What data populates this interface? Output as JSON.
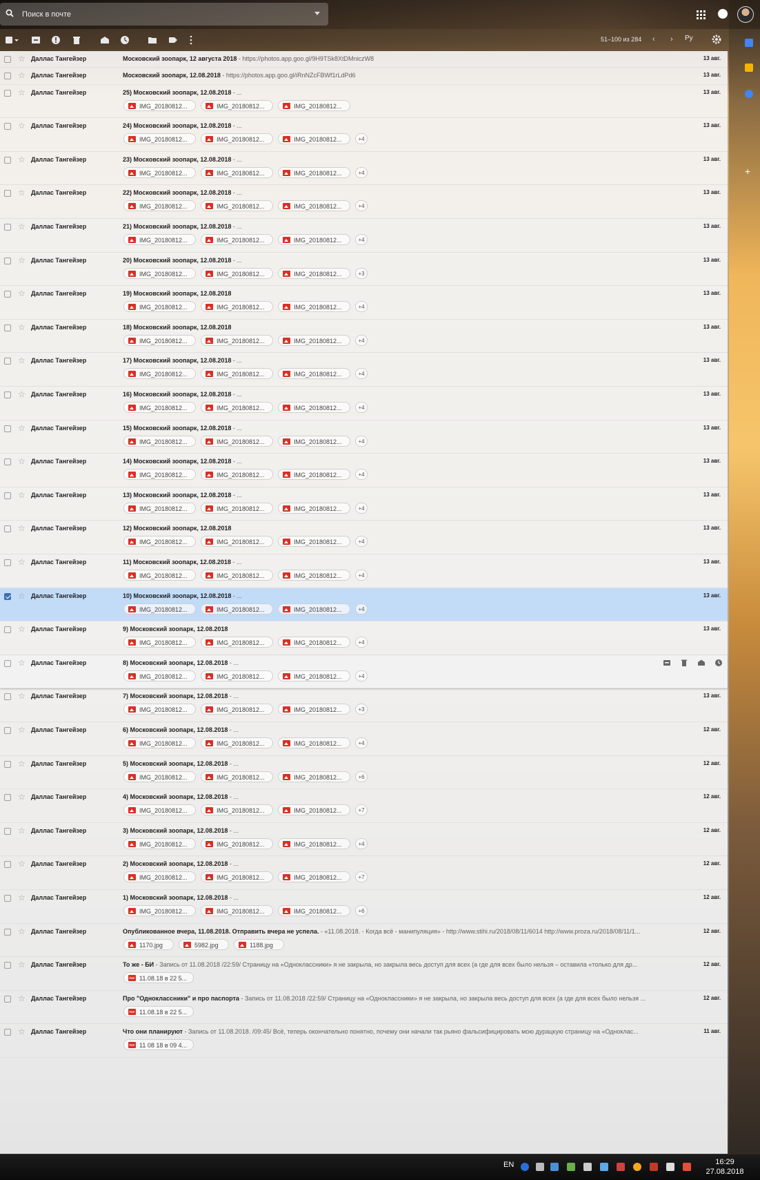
{
  "search": {
    "placeholder": "Поиск в почте"
  },
  "toolbar": {
    "pager": "51–100 из 284",
    "prev": "‹",
    "next": "›",
    "lang": "Ру"
  },
  "colors": {
    "selected_row": "#c2dbf7",
    "attachment_icon": "#d93025",
    "checkbox_checked": "#3c6fb3"
  },
  "emails": [
    {
      "sender": "Даллас Тангейзер",
      "subject": "Московский зоопарк, 12 августа 2018",
      "snippet": " - https://photos.app.goo.gl/9H9TSk8XtDMniczW8",
      "date": "13 авг.",
      "attachments": [],
      "more": ""
    },
    {
      "sender": "Даллас Тангейзер",
      "subject": "Московский зоопарк, 12.08.2018",
      "snippet": " - https://photos.app.goo.gl/iRnNZcFBWf1rLdPd6",
      "date": "13 авг.",
      "attachments": [],
      "more": ""
    },
    {
      "sender": "Даллас Тангейзер",
      "subject": "25) Московский зоопарк, 12.08.2018",
      "snippet": " - ...",
      "date": "13 авг.",
      "attachments": [
        "IMG_20180812...",
        "IMG_20180812...",
        "IMG_20180812..."
      ],
      "more": ""
    },
    {
      "sender": "Даллас Тангейзер",
      "subject": "24) Московский зоопарк, 12.08.2018",
      "snippet": " - ...",
      "date": "13 авг.",
      "attachments": [
        "IMG_20180812...",
        "IMG_20180812...",
        "IMG_20180812..."
      ],
      "more": "+4"
    },
    {
      "sender": "Даллас Тангейзер",
      "subject": "23) Московский зоопарк, 12.08.2018",
      "snippet": " - ...",
      "date": "13 авг.",
      "attachments": [
        "IMG_20180812...",
        "IMG_20180812...",
        "IMG_20180812..."
      ],
      "more": "+4"
    },
    {
      "sender": "Даллас Тангейзер",
      "subject": "22) Московский зоопарк, 12.08.2018",
      "snippet": " - ...",
      "date": "13 авг.",
      "attachments": [
        "IMG_20180812...",
        "IMG_20180812...",
        "IMG_20180812..."
      ],
      "more": "+4"
    },
    {
      "sender": "Даллас Тангейзер",
      "subject": "21) Московский зоопарк, 12.08.2018",
      "snippet": " - ...",
      "date": "13 авг.",
      "attachments": [
        "IMG_20180812...",
        "IMG_20180812...",
        "IMG_20180812..."
      ],
      "more": "+4"
    },
    {
      "sender": "Даллас Тангейзер",
      "subject": "20) Московский зоопарк, 12.08.2018",
      "snippet": " - ...",
      "date": "13 авг.",
      "attachments": [
        "IMG_20180812...",
        "IMG_20180812...",
        "IMG_20180812..."
      ],
      "more": "+3"
    },
    {
      "sender": "Даллас Тангейзер",
      "subject": "19) Московский зоопарк, 12.08.2018",
      "snippet": "",
      "date": "13 авг.",
      "attachments": [
        "IMG_20180812...",
        "IMG_20180812...",
        "IMG_20180812..."
      ],
      "more": "+4"
    },
    {
      "sender": "Даллас Тангейзер",
      "subject": "18) Московский зоопарк, 12.08.2018",
      "snippet": "",
      "date": "13 авг.",
      "attachments": [
        "IMG_20180812...",
        "IMG_20180812...",
        "IMG_20180812..."
      ],
      "more": "+4"
    },
    {
      "sender": "Даллас Тангейзер",
      "subject": "17) Московский зоопарк, 12.08.2018",
      "snippet": " - ...",
      "date": "13 авг.",
      "attachments": [
        "IMG_20180812...",
        "IMG_20180812...",
        "IMG_20180812..."
      ],
      "more": "+4"
    },
    {
      "sender": "Даллас Тангейзер",
      "subject": "16) Московский зоопарк, 12.08.2018",
      "snippet": " - ...",
      "date": "13 авг.",
      "attachments": [
        "IMG_20180812...",
        "IMG_20180812...",
        "IMG_20180812..."
      ],
      "more": "+4"
    },
    {
      "sender": "Даллас Тангейзер",
      "subject": "15) Московский зоопарк, 12.08.2018",
      "snippet": " - ...",
      "date": "13 авг.",
      "attachments": [
        "IMG_20180812...",
        "IMG_20180812...",
        "IMG_20180812..."
      ],
      "more": "+4"
    },
    {
      "sender": "Даллас Тангейзер",
      "subject": "14) Московский зоопарк, 12.08.2018",
      "snippet": " - ...",
      "date": "13 авг.",
      "attachments": [
        "IMG_20180812...",
        "IMG_20180812...",
        "IMG_20180812..."
      ],
      "more": "+4"
    },
    {
      "sender": "Даллас Тангейзер",
      "subject": "13) Московский зоопарк, 12.08.2018",
      "snippet": " - ...",
      "date": "13 авг.",
      "attachments": [
        "IMG_20180812...",
        "IMG_20180812...",
        "IMG_20180812..."
      ],
      "more": "+4"
    },
    {
      "sender": "Даллас Тангейзер",
      "subject": "12) Московский зоопарк, 12.08.2018",
      "snippet": "",
      "date": "13 авг.",
      "attachments": [
        "IMG_20180812...",
        "IMG_20180812...",
        "IMG_20180812..."
      ],
      "more": "+4"
    },
    {
      "sender": "Даллас Тангейзер",
      "subject": "11) Московский зоопарк, 12.08.2018",
      "snippet": " - ...",
      "date": "13 авг.",
      "attachments": [
        "IMG_20180812...",
        "IMG_20180812...",
        "IMG_20180812..."
      ],
      "more": "+4"
    },
    {
      "sender": "Даллас Тангейзер",
      "subject": "10) Московский зоопарк, 12.08.2018",
      "snippet": " - ...",
      "date": "13 авг.",
      "attachments": [
        "IMG_20180812...",
        "IMG_20180812...",
        "IMG_20180812..."
      ],
      "more": "+4",
      "selected": true
    },
    {
      "sender": "Даллас Тангейзер",
      "subject": "9) Московский зоопарк, 12.08.2018",
      "snippet": "",
      "date": "13 авг.",
      "attachments": [
        "IMG_20180812...",
        "IMG_20180812...",
        "IMG_20180812..."
      ],
      "more": "+4"
    },
    {
      "sender": "Даллас Тангейзер",
      "subject": "8) Московский зоопарк, 12.08.2018",
      "snippet": " - ...",
      "date": "",
      "attachments": [
        "IMG_20180812...",
        "IMG_20180812...",
        "IMG_20180812..."
      ],
      "more": "+4",
      "hovered": true
    },
    {
      "sender": "Даллас Тангейзер",
      "subject": "7) Московский зоопарк, 12.08.2018",
      "snippet": " - ...",
      "date": "13 авг.",
      "attachments": [
        "IMG_20180812...",
        "IMG_20180812...",
        "IMG_20180812..."
      ],
      "more": "+3"
    },
    {
      "sender": "Даллас Тангейзер",
      "subject": "6) Московский зоопарк, 12.08.2018",
      "snippet": " - ...",
      "date": "12 авг.",
      "attachments": [
        "IMG_20180812...",
        "IMG_20180812...",
        "IMG_20180812..."
      ],
      "more": "+4"
    },
    {
      "sender": "Даллас Тангейзер",
      "subject": "5) Московский зоопарк, 12.08.2018",
      "snippet": " - ...",
      "date": "12 авг.",
      "attachments": [
        "IMG_20180812...",
        "IMG_20180812...",
        "IMG_20180812..."
      ],
      "more": "+6"
    },
    {
      "sender": "Даллас Тангейзер",
      "subject": "4) Московский зоопарк, 12.08.2018",
      "snippet": " - ...",
      "date": "12 авг.",
      "attachments": [
        "IMG_20180812...",
        "IMG_20180812...",
        "IMG_20180812..."
      ],
      "more": "+7"
    },
    {
      "sender": "Даллас Тангейзер",
      "subject": "3) Московский зоопарк, 12.08.2018",
      "snippet": " - ...",
      "date": "12 авг.",
      "attachments": [
        "IMG_20180812...",
        "IMG_20180812...",
        "IMG_20180812..."
      ],
      "more": "+4"
    },
    {
      "sender": "Даллас Тангейзер",
      "subject": "2) Московский зоопарк, 12.08.2018",
      "snippet": " - ...",
      "date": "12 авг.",
      "attachments": [
        "IMG_20180812...",
        "IMG_20180812...",
        "IMG_20180812..."
      ],
      "more": "+7"
    },
    {
      "sender": "Даллас Тангейзер",
      "subject": "1) Московский зоопарк, 12.08.2018",
      "snippet": " - ...",
      "date": "12 авг.",
      "attachments": [
        "IMG_20180812...",
        "IMG_20180812...",
        "IMG_20180812..."
      ],
      "more": "+6"
    },
    {
      "sender": "Даллас Тангейзер",
      "subject": "Опубликованное вчера, 11.08.2018. Отправить вчера не успела.",
      "snippet": " - «11.08.2018. - Когда всё - манипуляция» - http://www.stihi.ru/2018/08/11/6014 http://www.proza.ru/2018/08/11/1...",
      "date": "12 авг.",
      "attachments": [
        "1170.jpg",
        "5982.jpg",
        "1188.jpg"
      ],
      "more": "",
      "short": true
    },
    {
      "sender": "Даллас Тангейзер",
      "subject": "То же - БИ",
      "snippet": " - Запись от 11.08.2018 /22:59/ Страницу на «Одноклассники» я не закрыла, но закрыла весь доступ для всех (а где для всех было нельзя – оставила «только для др...",
      "date": "12 авг.",
      "attachments": [
        "11.08.18 в 22 5..."
      ],
      "more": "",
      "pdf": true
    },
    {
      "sender": "Даллас Тангейзер",
      "subject": "Про \"Одноклассники\" и про паспорта",
      "snippet": " - Запись от 11.08.2018 /22:59/ Страницу на «Одноклассники» я не закрыла, но закрыла весь доступ для всех (а где для всех было нельзя ...",
      "date": "12 авг.",
      "attachments": [
        "11.08.18 в 22 5..."
      ],
      "more": "",
      "pdf": true
    },
    {
      "sender": "Даллас Тангейзер",
      "subject": "Что они планируют",
      "snippet": " - Запись от 11.08.2018. /09:45/ Всё, теперь окончательно понятно, почему они начали так рьяно фальсифицировать мою дурацкую страницу на «Одноклас...",
      "date": "11 авг.",
      "attachments": [
        "11 08 18 в 09 4..."
      ],
      "more": "",
      "pdf": true
    }
  ],
  "taskbar": {
    "lang": "EN",
    "time": "16:29",
    "date": "27.08.2018"
  }
}
